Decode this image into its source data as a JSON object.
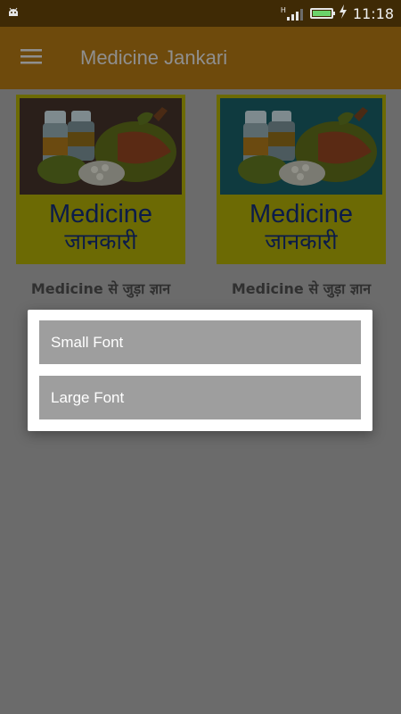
{
  "status_bar": {
    "time": "11:18",
    "network_label": "H",
    "battery_level": 1.0,
    "icons": [
      "android-icon",
      "signal-icon",
      "battery-icon",
      "charging-icon"
    ]
  },
  "app_bar": {
    "title": "Medicine Jankari",
    "menu_icon": "hamburger-menu-icon"
  },
  "tiles": [
    {
      "banner_line1": "Medicine",
      "banner_line2": "जानकारी",
      "caption": "Medicine  से जुड़ा ज्ञान"
    },
    {
      "banner_line1": "Medicine",
      "banner_line2": "जानकारी",
      "caption": "Medicine  से जुड़ा ज्ञान"
    }
  ],
  "dialog": {
    "options": [
      {
        "label": "Small Font"
      },
      {
        "label": "Large Font"
      }
    ]
  },
  "colors": {
    "app_bar": "#6e4a0c",
    "status_bar": "#3f2a05",
    "scrim_background": "#6b6b6b",
    "option_bg": "#9e9e9e",
    "banner_text": "#0b1b49"
  }
}
